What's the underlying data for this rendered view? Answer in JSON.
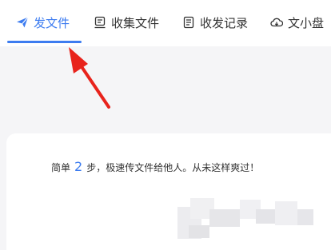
{
  "tabs": [
    {
      "label": "发文件",
      "icon": "paper-plane-icon",
      "active": true
    },
    {
      "label": "收集文件",
      "icon": "collect-box-icon",
      "active": false
    },
    {
      "label": "收发记录",
      "icon": "record-list-icon",
      "active": false
    },
    {
      "label": "文小盘",
      "icon": "cloud-drive-icon",
      "active": false
    }
  ],
  "slogan": {
    "prefix": "简单",
    "number": "2",
    "suffix": "步，极速传文件给他人。从未这样爽过！"
  },
  "colors": {
    "accent": "#3d7cf0",
    "annotation_arrow": "#e8231c",
    "text": "#333333"
  }
}
